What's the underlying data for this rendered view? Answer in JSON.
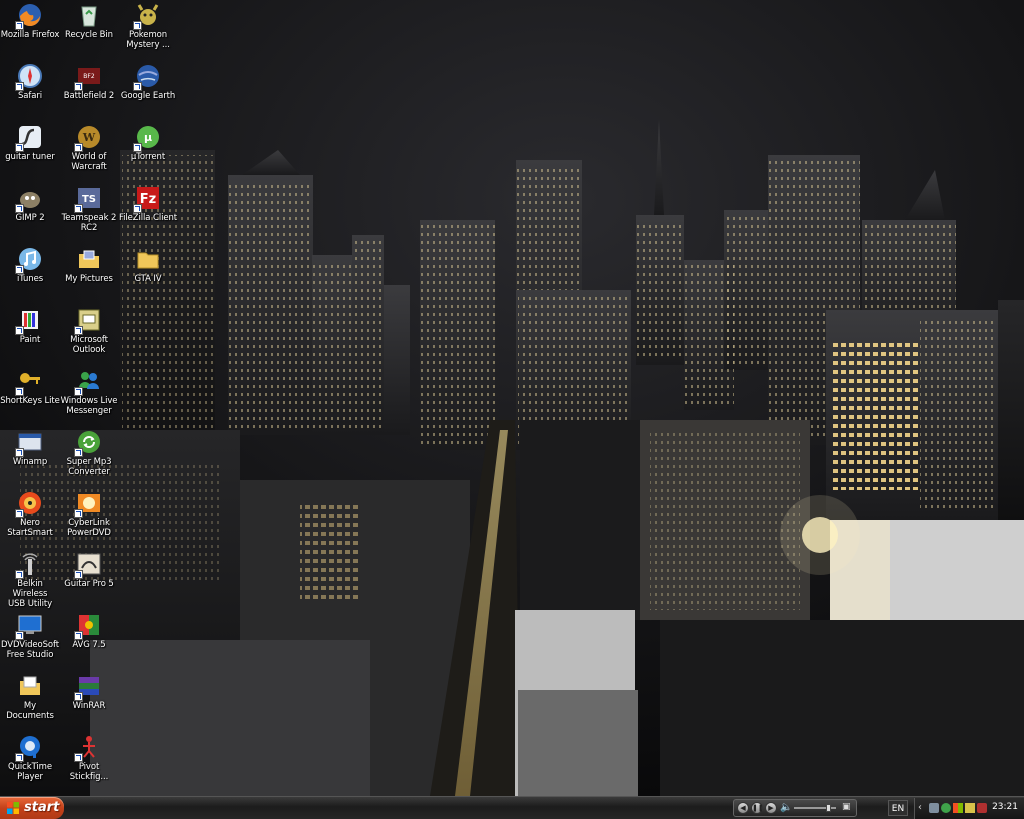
{
  "desktop": {
    "columns": [
      {
        "icons": [
          {
            "label": "Mozilla Firefox",
            "icon": "firefox-icon"
          },
          {
            "label": "Safari",
            "icon": "safari-icon"
          },
          {
            "label": "guitar tuner",
            "icon": "flash-icon"
          },
          {
            "label": "GIMP 2",
            "icon": "gimp-icon"
          },
          {
            "label": "iTunes",
            "icon": "itunes-icon"
          },
          {
            "label": "Paint",
            "icon": "paint-icon"
          },
          {
            "label": "ShortKeys Lite",
            "icon": "key-icon"
          },
          {
            "label": "Winamp",
            "icon": "winamp-icon"
          },
          {
            "label": "Nero\nStartSmart",
            "icon": "nero-icon"
          },
          {
            "label": "Belkin Wireless\nUSB Utility",
            "icon": "wireless-icon"
          },
          {
            "label": "DVDVideoSoft\nFree Studio",
            "icon": "monitor-icon"
          },
          {
            "label": "My Documents",
            "icon": "documents-icon"
          },
          {
            "label": "QuickTime\nPlayer",
            "icon": "quicktime-icon"
          }
        ]
      },
      {
        "icons": [
          {
            "label": "Recycle Bin",
            "icon": "recycle-bin-icon"
          },
          {
            "label": "Battlefield 2",
            "icon": "battlefield-icon"
          },
          {
            "label": "World of\nWarcraft",
            "icon": "warcraft-icon"
          },
          {
            "label": "Teamspeak 2\nRC2",
            "icon": "teamspeak-icon"
          },
          {
            "label": "My Pictures",
            "icon": "pictures-folder-icon"
          },
          {
            "label": "Microsoft\nOutlook",
            "icon": "outlook-icon"
          },
          {
            "label": "Windows Live\nMessenger",
            "icon": "messenger-icon"
          },
          {
            "label": "Super Mp3\nConverter",
            "icon": "converter-icon"
          },
          {
            "label": "CyberLink\nPowerDVD",
            "icon": "powerdvd-icon"
          },
          {
            "label": "Guitar Pro 5",
            "icon": "guitar-pro-icon"
          },
          {
            "label": "AVG 7.5",
            "icon": "avg-icon"
          },
          {
            "label": "WinRAR",
            "icon": "winrar-icon"
          },
          {
            "label": "Pivot\nStickfig...",
            "icon": "stickfigure-icon"
          }
        ]
      },
      {
        "icons": [
          {
            "label": "Pokemon\nMystery ...",
            "icon": "pokemon-icon"
          },
          {
            "label": "Google Earth",
            "icon": "google-earth-icon"
          },
          {
            "label": "µTorrent",
            "icon": "utorrent-icon"
          },
          {
            "label": "FileZilla Client",
            "icon": "filezilla-icon"
          },
          {
            "label": "GTA IV",
            "icon": "folder-icon"
          }
        ]
      }
    ]
  },
  "taskbar": {
    "start_label": "start",
    "language": "EN",
    "clock": "23:21",
    "media_controls": {
      "prev": "previous-icon",
      "pause": "pause-icon",
      "next": "next-icon",
      "volume_level": 0.8
    },
    "tray_icons": [
      "network-icon",
      "messenger-tray-icon",
      "flag-tray-icon",
      "speaker-tray-icon",
      "shield-tray-icon"
    ]
  },
  "colors": {
    "start_button": "#c4411a",
    "taskbar": "#262626",
    "label_text": "#ffffff"
  }
}
